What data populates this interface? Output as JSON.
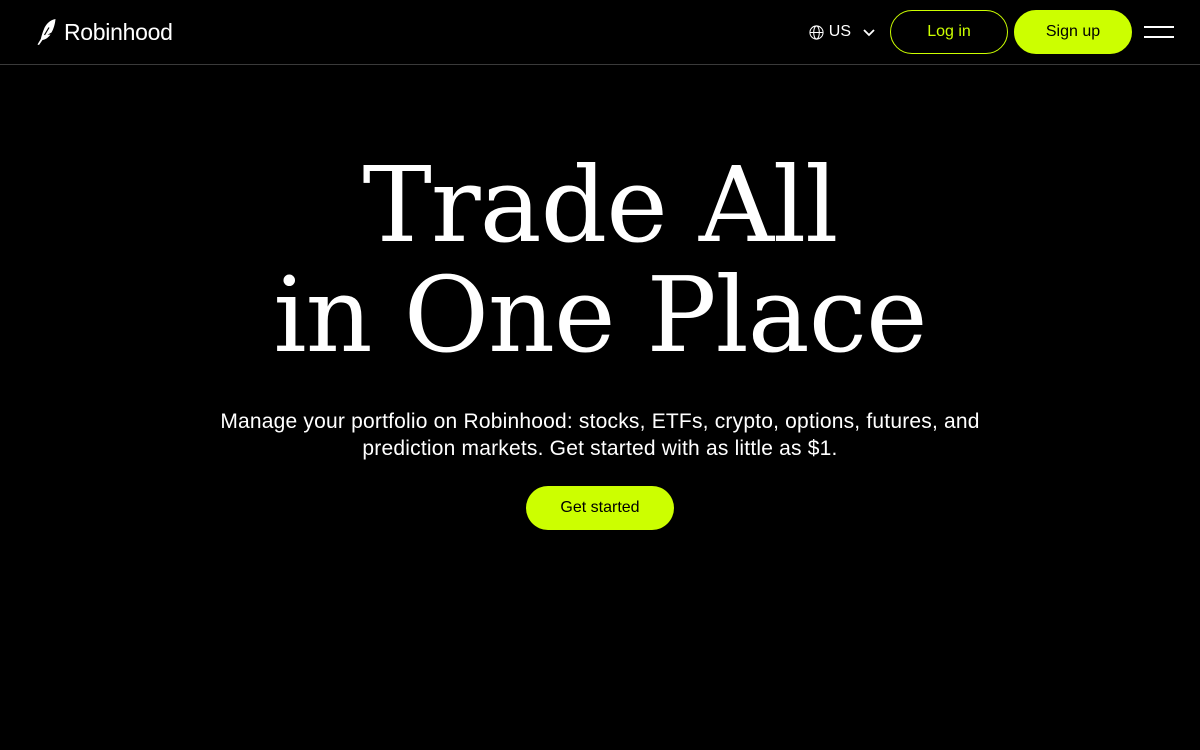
{
  "header": {
    "logo_text": "Robinhood",
    "locale_label": "US",
    "login_label": "Log in",
    "signup_label": "Sign up"
  },
  "hero": {
    "title_line1": "Trade All",
    "title_line2": "in One Place",
    "subtitle_line1": "Manage your portfolio on Robinhood: stocks, ETFs, crypto, options, futures, and",
    "subtitle_line2": "prediction markets. Get started with as little as $1.",
    "cta_label": "Get started"
  },
  "colors": {
    "background": "#000000",
    "accent": "#ccff00",
    "text": "#ffffff"
  },
  "icons": {
    "logo": "feather-icon",
    "locale": "globe-icon",
    "dropdown": "chevron-down-icon",
    "menu": "hamburger-menu-icon"
  }
}
